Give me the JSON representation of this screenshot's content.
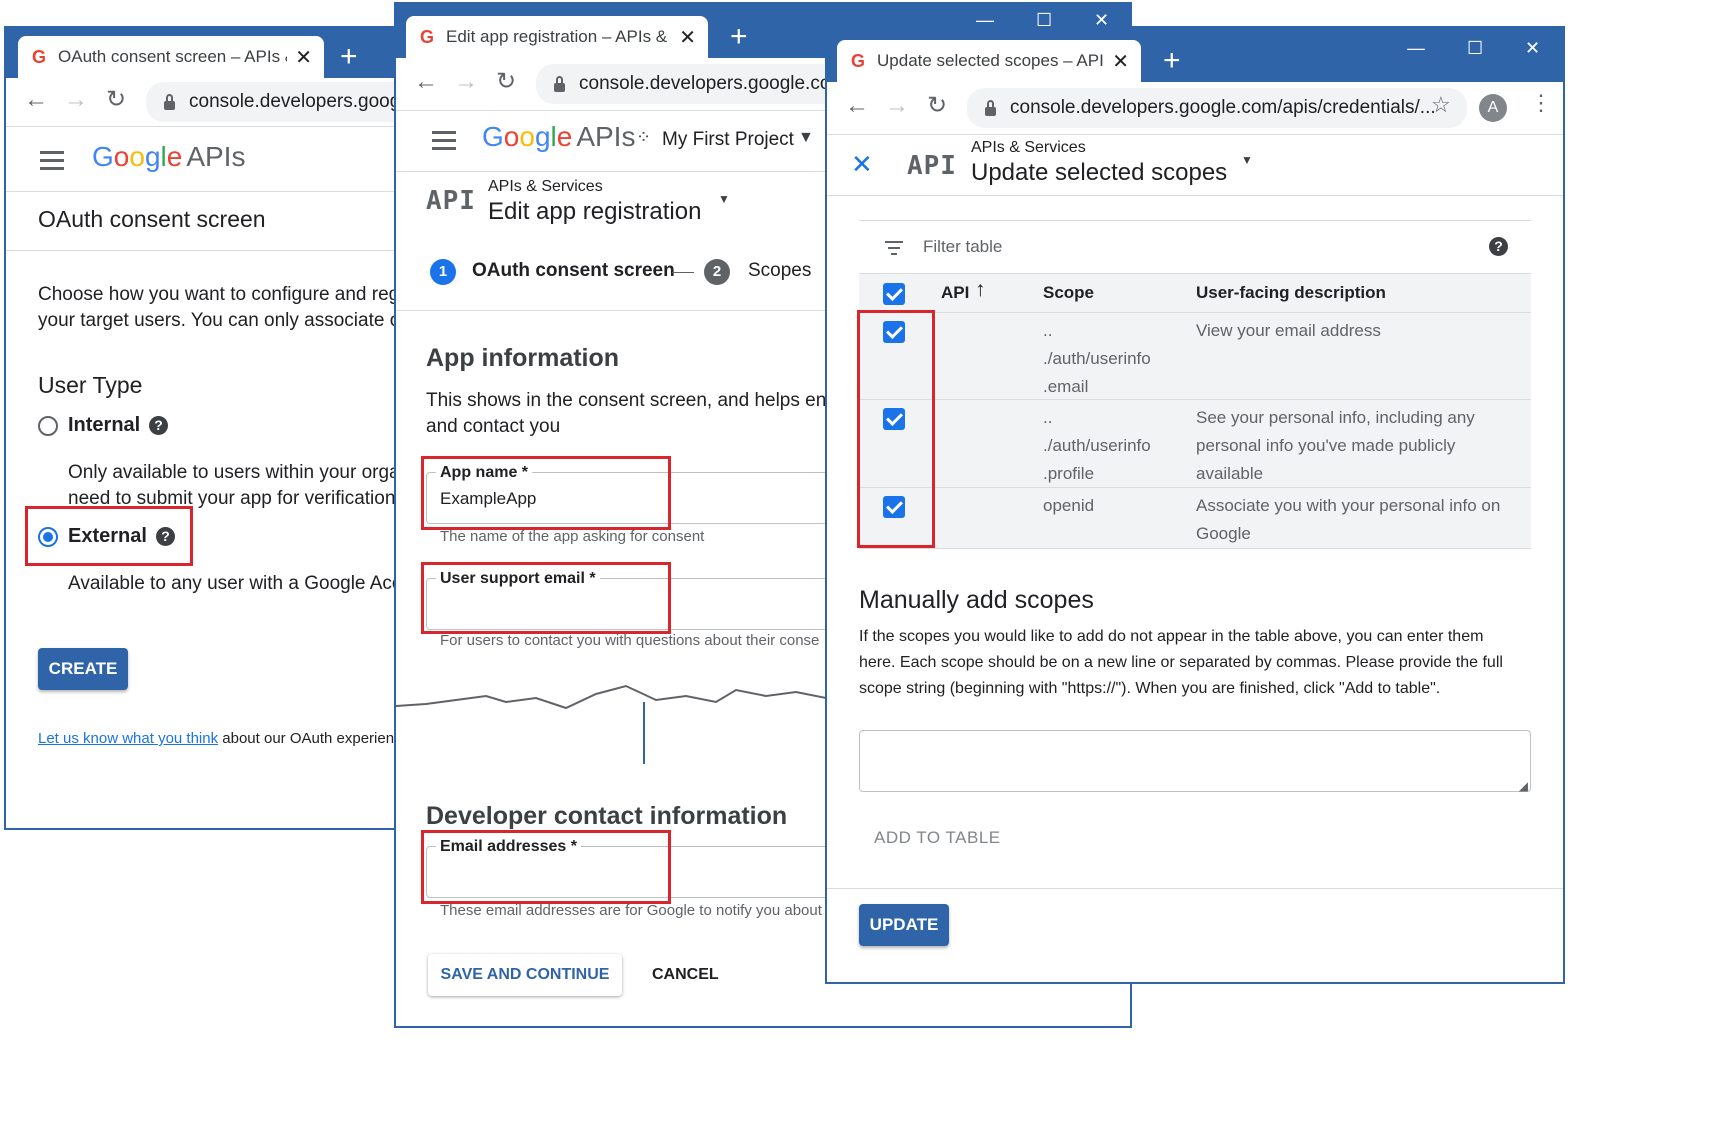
{
  "window1": {
    "tab_title": "OAuth consent screen – APIs & S",
    "url": "console.developers.google",
    "logo_google": [
      "G",
      "o",
      "o",
      "g",
      "l",
      "e"
    ],
    "logo_apis": "APIs",
    "page_title": "OAuth consent screen",
    "intro_line1": "Choose how you want to configure and reg",
    "intro_line2": "your target users. You can only associate o",
    "user_type_heading": "User Type",
    "internal_label": "Internal",
    "internal_desc_line1": "Only available to users within your orga",
    "internal_desc_line2": "need to submit your app for verification",
    "external_label": "External",
    "external_desc": "Available to any user with a Google Acc",
    "create_button": "CREATE",
    "feedback_link": "Let us know what you think",
    "feedback_text": " about our OAuth experience"
  },
  "window2": {
    "tab_title": "Edit app registration – APIs & Se",
    "url": "console.developers.google.com",
    "logo_apis": "APIs",
    "project_name": "My First Project",
    "api_badge": "API",
    "section_label": "APIs & Services",
    "page_title": "Edit app registration",
    "step1_num": "1",
    "step1_label": "OAuth consent screen",
    "step2_num": "2",
    "step2_label": "Scopes",
    "app_info_heading": "App information",
    "app_info_desc_line1": "This shows in the consent screen, and helps en",
    "app_info_desc_line2": "and contact you",
    "app_name_label": "App name *",
    "app_name_value": "ExampleApp",
    "app_name_hint": "The name of the app asking for consent",
    "support_email_label": "User support email *",
    "support_email_hint": "For users to contact you with questions about their conse",
    "dev_contact_heading": "Developer contact information",
    "email_label": "Email addresses *",
    "email_hint": "These email addresses are for Google to notify you about",
    "save_button": "SAVE AND CONTINUE",
    "cancel_button": "CANCEL"
  },
  "window3": {
    "tab_title": "Update selected scopes – APIs &",
    "url": "console.developers.google.com/apis/credentials/...",
    "avatar_letter": "A",
    "api_badge": "API",
    "section_label": "APIs & Services",
    "page_title": "Update selected scopes",
    "filter_placeholder": "Filter table",
    "columns": {
      "api": "API",
      "scope": "Scope",
      "description": "User-facing description"
    },
    "rows": [
      {
        "scope_lines": [
          "..",
          "./auth/userinfo",
          ".email"
        ],
        "description_lines": [
          "View your email address"
        ],
        "checked": true
      },
      {
        "scope_lines": [
          "..",
          "./auth/userinfo",
          ".profile"
        ],
        "description_lines": [
          "See your personal info, including any",
          "personal info you've made publicly",
          "available"
        ],
        "checked": true
      },
      {
        "scope_lines": [
          "openid"
        ],
        "description_lines": [
          "Associate you with your personal info on",
          "Google"
        ],
        "checked": true
      }
    ],
    "manual_heading": "Manually add scopes",
    "manual_desc_line1": "If the scopes you would like to add do not appear in the table above, you can enter them",
    "manual_desc_line2": "here. Each scope should be on a new line or separated by commas. Please provide the full",
    "manual_desc_line3": "scope string (beginning with \"https://\"). When you are finished, click \"Add to table\".",
    "add_to_table_button": "ADD TO TABLE",
    "update_button": "UPDATE"
  },
  "colors": {
    "chrome_blue": "#2f65a8",
    "highlight_red": "#d9262c",
    "checkbox_blue": "#1a73e8"
  }
}
